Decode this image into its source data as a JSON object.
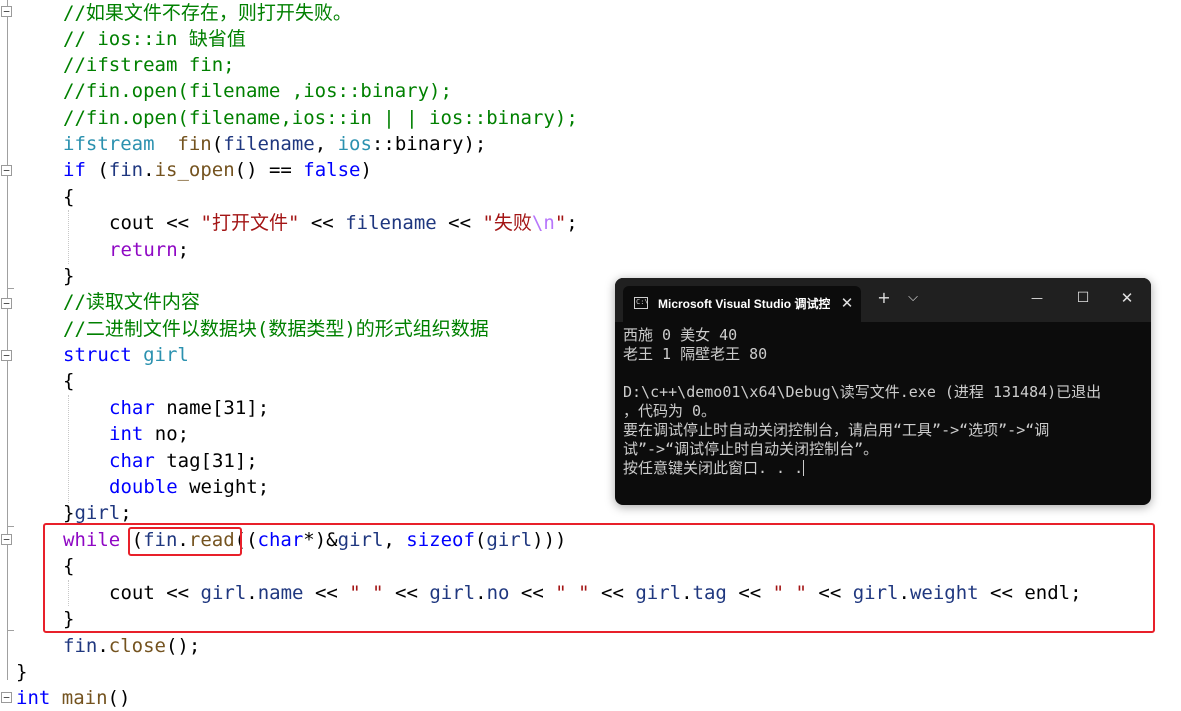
{
  "editor": {
    "lines": [
      {
        "kind": "comment",
        "text": "//如果文件不存在，则打开失败。"
      },
      {
        "kind": "comment",
        "text": "// ios::in 缺省值"
      },
      {
        "kind": "comment",
        "text": "//ifstream fin;"
      },
      {
        "kind": "comment",
        "text": "//fin.open(filename ,ios::binary);"
      },
      {
        "kind": "comment",
        "text": "//fin.open(filename,ios::in | | ios::binary);"
      },
      {
        "kind": "code",
        "id": "ifstream_line"
      },
      {
        "kind": "code",
        "id": "if_line"
      },
      {
        "kind": "brace",
        "text": "{"
      },
      {
        "kind": "code",
        "id": "cout_fail_line"
      },
      {
        "kind": "code",
        "id": "return_line"
      },
      {
        "kind": "brace",
        "text": "}"
      },
      {
        "kind": "comment",
        "text": "//读取文件内容"
      },
      {
        "kind": "comment",
        "text": "//二进制文件以数据块(数据类型)的形式组织数据"
      },
      {
        "kind": "code",
        "id": "struct_line"
      },
      {
        "kind": "brace",
        "text": "{"
      },
      {
        "kind": "code",
        "id": "field_name"
      },
      {
        "kind": "code",
        "id": "field_no"
      },
      {
        "kind": "code",
        "id": "field_tag"
      },
      {
        "kind": "code",
        "id": "field_weight"
      },
      {
        "kind": "code",
        "id": "struct_end"
      },
      {
        "kind": "code",
        "id": "while_line"
      },
      {
        "kind": "brace",
        "text": "{"
      },
      {
        "kind": "code",
        "id": "cout_girl_line"
      },
      {
        "kind": "brace",
        "text": "}"
      },
      {
        "kind": "code",
        "id": "close_line"
      },
      {
        "kind": "brace",
        "text": "}"
      },
      {
        "kind": "code",
        "id": "main_line"
      }
    ],
    "code": {
      "ifstream_line": [
        [
          "ty",
          "ifstream"
        ],
        [
          "",
          "  "
        ],
        [
          "fn",
          "fin"
        ],
        [
          "",
          "("
        ],
        [
          "var",
          "filename"
        ],
        [
          "",
          ", "
        ],
        [
          "ty",
          "ios"
        ],
        [
          "",
          "::"
        ],
        [
          "",
          "binary);"
        ]
      ],
      "if_line": [
        [
          "kw",
          "if"
        ],
        [
          "",
          " ("
        ],
        [
          "var",
          "fin"
        ],
        [
          "",
          "."
        ],
        [
          "fn",
          "is_open"
        ],
        [
          "",
          "() == "
        ],
        [
          "kw",
          "false"
        ],
        [
          "",
          ")"
        ]
      ],
      "cout_fail_line": [
        [
          "",
          "cout "
        ],
        [
          "",
          "<< "
        ],
        [
          "st",
          "\"打开文件\""
        ],
        [
          "",
          " << "
        ],
        [
          "var",
          "filename"
        ],
        [
          "",
          " << "
        ],
        [
          "st",
          "\"失败"
        ],
        [
          "esc",
          "\\n"
        ],
        [
          "st",
          "\""
        ],
        [
          "",
          ";"
        ]
      ],
      "return_line": [
        [
          "ret",
          "return"
        ],
        [
          "",
          ";"
        ]
      ],
      "struct_line": [
        [
          "kw",
          "struct"
        ],
        [
          "",
          " "
        ],
        [
          "ty",
          "girl"
        ]
      ],
      "field_name": [
        [
          "kw",
          "char"
        ],
        [
          "",
          " name[31];"
        ]
      ],
      "field_no": [
        [
          "kw",
          "int"
        ],
        [
          "",
          " no;"
        ]
      ],
      "field_tag": [
        [
          "kw",
          "char"
        ],
        [
          "",
          " tag[31];"
        ]
      ],
      "field_weight": [
        [
          "kw",
          "double"
        ],
        [
          "",
          " weight;"
        ]
      ],
      "struct_end": [
        [
          "",
          "}"
        ],
        [
          "var",
          "girl"
        ],
        [
          "",
          ";"
        ]
      ],
      "while_line": [
        [
          "ret",
          "while"
        ],
        [
          "",
          " ("
        ],
        [
          "var",
          "fin"
        ],
        [
          "",
          "."
        ],
        [
          "fn",
          "read"
        ],
        [
          "",
          "(("
        ],
        [
          "kw",
          "char"
        ],
        [
          "",
          "*)&"
        ],
        [
          "var",
          "girl"
        ],
        [
          "",
          ", "
        ],
        [
          "kw",
          "sizeof"
        ],
        [
          "",
          "("
        ],
        [
          "var",
          "girl"
        ],
        [
          "",
          ")))"
        ]
      ],
      "cout_girl_line": [
        [
          "",
          "cout << "
        ],
        [
          "var",
          "girl"
        ],
        [
          "",
          "."
        ],
        [
          "mem",
          "name"
        ],
        [
          "",
          " << "
        ],
        [
          "st",
          "\" \""
        ],
        [
          "",
          " << "
        ],
        [
          "var",
          "girl"
        ],
        [
          "",
          "."
        ],
        [
          "mem",
          "no"
        ],
        [
          "",
          " << "
        ],
        [
          "st",
          "\" \""
        ],
        [
          "",
          " << "
        ],
        [
          "var",
          "girl"
        ],
        [
          "",
          "."
        ],
        [
          "mem",
          "tag"
        ],
        [
          "",
          " << "
        ],
        [
          "st",
          "\" \""
        ],
        [
          "",
          " << "
        ],
        [
          "var",
          "girl"
        ],
        [
          "",
          "."
        ],
        [
          "mem",
          "weight"
        ],
        [
          "",
          " << endl;"
        ]
      ],
      "close_line": [
        [
          "var",
          "fin"
        ],
        [
          "",
          "."
        ],
        [
          "fn",
          "close"
        ],
        [
          "",
          "();"
        ]
      ],
      "main_line": [
        [
          "kw",
          "int"
        ],
        [
          "",
          " "
        ],
        [
          "fn",
          "main"
        ],
        [
          "",
          "()"
        ]
      ]
    }
  },
  "console": {
    "icon": "terminal-icon",
    "tab_icon_text": "C:\\",
    "tab_title": "Microsoft Visual Studio 调试控制台",
    "tab_close": "✕",
    "new_tab": "+",
    "dropdown": "⌵",
    "minimize": "—",
    "maximize": "☐",
    "close": "✕",
    "lines": [
      "西施 0 美女 40",
      "老王 1 隔壁老王 80",
      "",
      "D:\\c++\\demo01\\x64\\Debug\\读写文件.exe (进程 131484)已退出",
      "，代码为 0。",
      "要在调试停止时自动关闭控制台，请启用“工具”->“选项”->“调",
      "试”->“调试停止时自动关闭控制台”。",
      "按任意键关闭此窗口. . ."
    ]
  },
  "colors": {
    "highlight": "#e8202a",
    "keyword": "#0000ff",
    "type": "#2b91af",
    "comment": "#008000",
    "string": "#a31515",
    "console_bg": "#0c0c0c"
  }
}
